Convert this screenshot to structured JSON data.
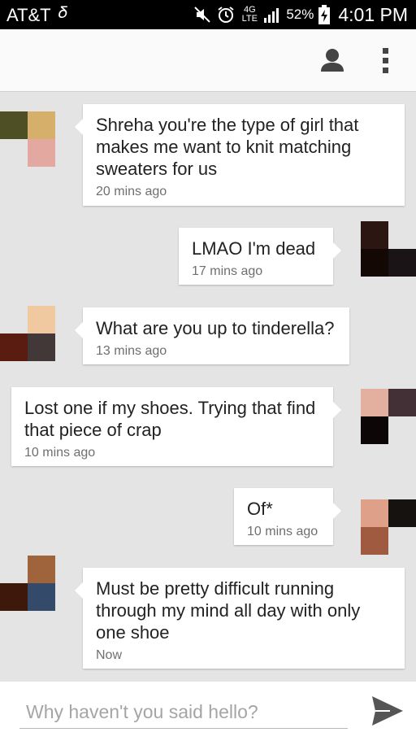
{
  "status_bar": {
    "carrier": "AT&T",
    "network": "4G LTE",
    "battery_percent": "52%",
    "time": "4:01 PM",
    "icons": [
      "usb-icon",
      "mute-icon",
      "alarm-icon",
      "signal-icon",
      "battery-charging-icon"
    ]
  },
  "app_bar": {
    "icons": [
      "person-icon",
      "more-vert-icon"
    ]
  },
  "messages": [
    {
      "side": "incoming",
      "text": "Shreha you're the type of girl that makes me want to knit matching sweaters for us",
      "time": "20 mins ago"
    },
    {
      "side": "outgoing",
      "text": "LMAO I'm dead",
      "time": "17 mins ago"
    },
    {
      "side": "incoming",
      "text": "What are you up to tinderella?",
      "time": "13 mins ago"
    },
    {
      "side": "outgoing",
      "text": "Lost one if my shoes. Trying that find that piece of crap",
      "time": "10 mins ago"
    },
    {
      "side": "outgoing",
      "text": "Of*",
      "time": "10 mins ago"
    },
    {
      "side": "incoming",
      "text": "Must be pretty difficult running through my mind all day with only one shoe",
      "time": "Now"
    }
  ],
  "composer": {
    "placeholder": "Why haven't you said hello?",
    "value": ""
  },
  "colors": {
    "background": "#e4e4e4",
    "bubble": "#ffffff",
    "status_bar": "#000000",
    "app_bar": "#fafafa",
    "icon": "#444444",
    "send_icon": "#555555"
  }
}
